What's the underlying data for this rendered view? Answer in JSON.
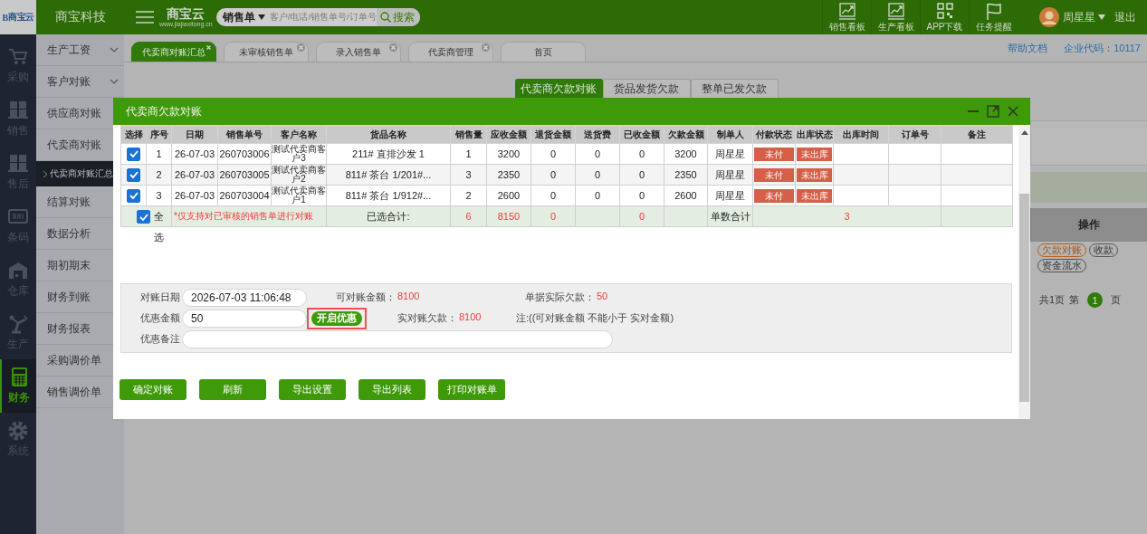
{
  "topbar": {
    "logo_mark": "B",
    "logo": "商宝云",
    "company": "商宝科技",
    "brand": "商宝云",
    "brand_url": "www.jiajiaxitong.cn",
    "search": {
      "scope": "销售单",
      "placeholder": "客户/电话/销售单号/订单号",
      "button": "搜索"
    },
    "shortcuts": [
      {
        "label": "销售看板",
        "kind": "chart"
      },
      {
        "label": "生产看板",
        "kind": "chart"
      },
      {
        "label": "APP下载",
        "kind": "qr"
      },
      {
        "label": "任务提醒",
        "kind": "flag"
      }
    ],
    "user": "周星星",
    "logout": "退出"
  },
  "sidebar": {
    "items": [
      {
        "label": "采购",
        "kind": "cart",
        "selected": false
      },
      {
        "label": "销售",
        "kind": "boxes",
        "selected": false
      },
      {
        "label": "售后",
        "kind": "boxes",
        "selected": false
      },
      {
        "label": "条码",
        "kind": "barcode",
        "selected": false
      },
      {
        "label": "仓库",
        "kind": "warehouse",
        "selected": false
      },
      {
        "label": "生产",
        "kind": "robot",
        "selected": false
      },
      {
        "label": "财务",
        "kind": "calculator",
        "selected": true
      },
      {
        "label": "系统",
        "kind": "gear",
        "selected": false
      }
    ]
  },
  "menu": {
    "items": [
      {
        "label": "生产工资",
        "kind": "group",
        "selected": false
      },
      {
        "label": "客户对账",
        "kind": "group",
        "selected": false
      },
      {
        "label": "供应商对账",
        "kind": "link",
        "selected": false
      },
      {
        "label": "代卖商对账",
        "kind": "link",
        "selected": false,
        "children": [
          {
            "label": "代卖商对账汇总",
            "selected": true
          }
        ]
      },
      {
        "label": "结算对账",
        "kind": "link",
        "selected": false
      },
      {
        "label": "数据分析",
        "kind": "link",
        "selected": false
      },
      {
        "label": "期初期末",
        "kind": "link",
        "selected": false
      },
      {
        "label": "财务到账",
        "kind": "link",
        "selected": false
      },
      {
        "label": "财务报表",
        "kind": "link",
        "selected": false
      },
      {
        "label": "采购调价单",
        "kind": "link",
        "selected": false
      },
      {
        "label": "销售调价单",
        "kind": "link",
        "selected": false
      }
    ]
  },
  "tabs": [
    {
      "label": "代卖商对账汇总",
      "selected": true,
      "closable": true
    },
    {
      "label": "未审核销售单",
      "selected": false,
      "closable": true
    },
    {
      "label": "录入销售单",
      "selected": false,
      "closable": true
    },
    {
      "label": "代卖商管理",
      "selected": false,
      "closable": true
    },
    {
      "label": "首页",
      "selected": false,
      "closable": false
    }
  ],
  "header_links": {
    "help": "帮助文档",
    "company_code": "企业代码：10117"
  },
  "subtabs": [
    {
      "label": "代卖商欠款对账",
      "selected": true
    },
    {
      "label": "货品发货欠款",
      "selected": false
    },
    {
      "label": "整单已发欠款",
      "selected": false
    }
  ],
  "background": {
    "column_header": "操作",
    "actions": [
      {
        "label": "欠款对账",
        "kind": "primary"
      },
      {
        "label": "收款",
        "kind": "plain"
      },
      {
        "label": "资金流水",
        "kind": "plain"
      }
    ],
    "pagination": {
      "total": "共1页",
      "page_label": "第",
      "page": "1",
      "unit": "页"
    }
  },
  "dialog": {
    "title": "代卖商欠款对账",
    "table": {
      "select_column": "选择",
      "columns": [
        {
          "label": "序号",
          "kind": "text"
        },
        {
          "label": "日期",
          "kind": "text"
        },
        {
          "label": "销售单号",
          "kind": "text"
        },
        {
          "label": "客户名称",
          "kind": "small"
        },
        {
          "label": "货品名称",
          "kind": "text"
        },
        {
          "label": "销售量",
          "kind": "text"
        },
        {
          "label": "应收金额",
          "kind": "text"
        },
        {
          "label": "退货金额",
          "kind": "text"
        },
        {
          "label": "送货费",
          "kind": "text"
        },
        {
          "label": "已收金额",
          "kind": "text"
        },
        {
          "label": "欠款金额",
          "kind": "text"
        },
        {
          "label": "制单人",
          "kind": "text"
        },
        {
          "label": "付款状态",
          "kind": "badge"
        },
        {
          "label": "出库状态",
          "kind": "badge"
        },
        {
          "label": "出库时间"
        },
        {
          "label": "订单号"
        },
        {
          "label": "备注"
        }
      ],
      "rows": [
        {
          "checked": true,
          "cells": [
            "1",
            "26-07-03",
            "260703006",
            "测试代卖商客户3",
            "211# 直排沙发 1",
            "1",
            "3200",
            "0",
            "0",
            "0",
            "3200",
            "周星星",
            "未付",
            "未出库"
          ]
        },
        {
          "checked": true,
          "cells": [
            "2",
            "26-07-03",
            "260703005",
            "测试代卖商客户2",
            "811# 茶台 1/201#...",
            "3",
            "2350",
            "0",
            "0",
            "0",
            "2350",
            "周星星",
            "未付",
            "未出库"
          ]
        },
        {
          "checked": true,
          "cells": [
            "3",
            "26-07-03",
            "260703004",
            "测试代卖商客户1",
            "811# 茶台 1/912#...",
            "2",
            "2600",
            "0",
            "0",
            "0",
            "2600",
            "周星星",
            "未付",
            "未出库"
          ]
        }
      ],
      "summary": {
        "checked": true,
        "select_all": "全选",
        "note": "*仅支持对已审核的销售单进行对账",
        "total_label": "已选合计:",
        "qty": "6",
        "receivable": "8150",
        "returned": "0",
        "received": "0",
        "count_label": "单数合计",
        "count": "3"
      }
    },
    "form": {
      "date_label": "对账日期",
      "date": "2026-07-03 11:06:48",
      "available_label": "可对账金额：",
      "available": "8100",
      "actual_label": "单据实际欠款：",
      "actual": "50",
      "discount_label": "优惠金额",
      "discount": "50",
      "discount_button": "开启优惠",
      "discount_highlighted": true,
      "net_label": "实对账欠款：",
      "net": "8100",
      "note": "注:((可对账金额 不能小于 实对金额)",
      "remark_label": "优惠备注"
    },
    "buttons": [
      "确定对账",
      "刷新",
      "导出设置",
      "导出列表",
      "打印对账单"
    ]
  }
}
